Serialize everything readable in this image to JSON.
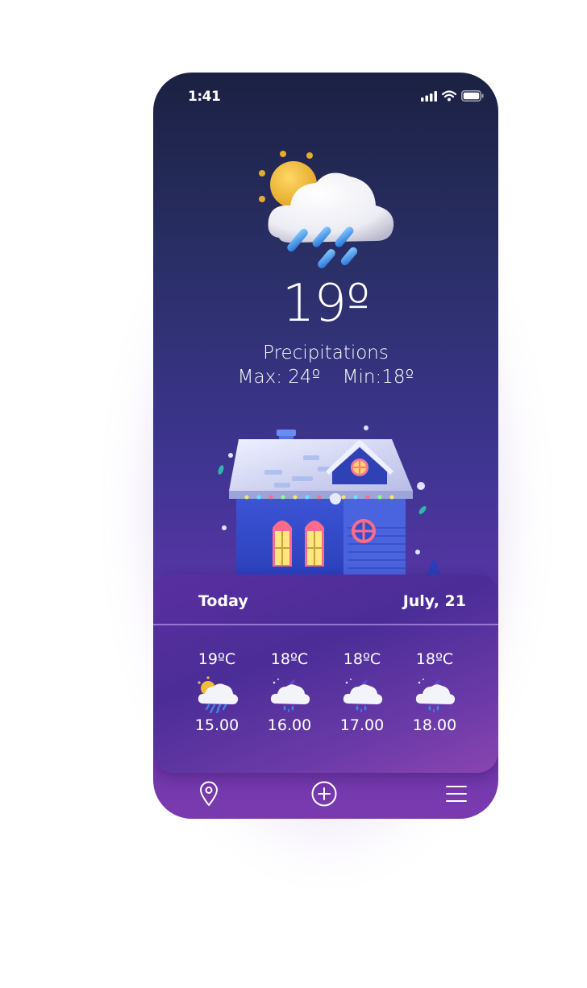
{
  "status_bar": {
    "time": "1:41"
  },
  "current": {
    "icon": "sun-cloud-rain-icon",
    "temperature": "19º",
    "condition": "Precipitations",
    "max": "Max: 24º",
    "min": "Min:18º"
  },
  "forecast_panel": {
    "day_label": "Today",
    "date_label": "July, 21",
    "hours": [
      {
        "temp": "19ºC",
        "icon": "sun-cloud-rain-icon",
        "time": "15.00"
      },
      {
        "temp": "18ºC",
        "icon": "moon-cloud-rain-icon",
        "time": "16.00"
      },
      {
        "temp": "18ºC",
        "icon": "moon-cloud-rain-icon",
        "time": "17.00"
      },
      {
        "temp": "18ºC",
        "icon": "moon-cloud-rain-icon",
        "time": "18.00"
      }
    ]
  },
  "nav": {
    "items": [
      {
        "icon": "location-pin-icon"
      },
      {
        "icon": "add-circle-icon"
      },
      {
        "icon": "menu-icon"
      }
    ]
  },
  "colors": {
    "background_top": "#1b2142",
    "background_bottom": "#7a3aaf",
    "panel": "#4b2d97",
    "text": "#ffffff"
  }
}
